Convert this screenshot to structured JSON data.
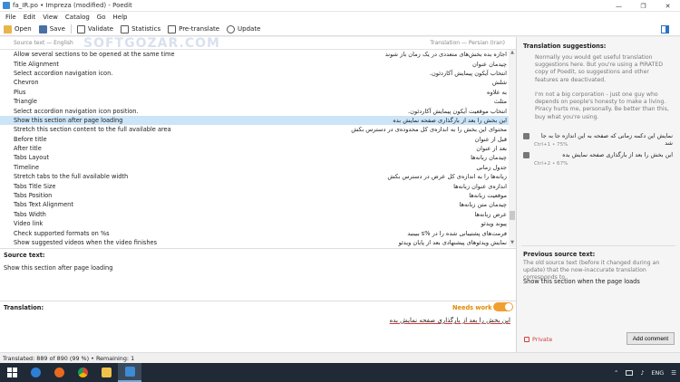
{
  "window": {
    "title": "fa_IR.po • Impreza (modified) - Poedit"
  },
  "menu": [
    "File",
    "Edit",
    "View",
    "Catalog",
    "Go",
    "Help"
  ],
  "toolbar": {
    "open": "Open",
    "save": "Save",
    "validate": "Validate",
    "statistics": "Statistics",
    "pretranslate": "Pre-translate",
    "update": "Update"
  },
  "list": {
    "source_header": "Source text — English",
    "translation_header": "Translation — Persian (Iran)",
    "rows": [
      {
        "src": "Allow several sections to be opened at the same time",
        "trn": "اجازه بده بخش‌های متعددی در یک زمان باز شوند"
      },
      {
        "src": "Title Alignment",
        "trn": "چیدمان عنوان"
      },
      {
        "src": "Select accordion navigation icon.",
        "trn": "انتخاب آیکون پیمایش آکاردئون."
      },
      {
        "src": "Chevron",
        "trn": "شلش"
      },
      {
        "src": "Plus",
        "trn": "به علاوه"
      },
      {
        "src": "Triangle",
        "trn": "مثلث"
      },
      {
        "src": "Select accordion navigation icon position.",
        "trn": "انتخاب موقعیت آیکون پیمایش آکاردئون."
      },
      {
        "src": "Show this section after page loading",
        "trn": "این بخش را بعد از بارگذاری صفحه نمایش بده",
        "selected": true
      },
      {
        "src": "Stretch this section content to the full available area",
        "trn": "محتوای این بخش را به اندازه‌ی کل محدوده‌ی در دسترس بکش"
      },
      {
        "src": "Before title",
        "trn": "قبل از عنوان"
      },
      {
        "src": "After title",
        "trn": "بعد از عنوان"
      },
      {
        "src": "Tabs Layout",
        "trn": "چیدمان زبانه‌ها"
      },
      {
        "src": "Timeline",
        "trn": "جدول زمانی"
      },
      {
        "src": "Stretch tabs to the full available width",
        "trn": "زبانه‌ها را به اندازه‌ی کل عرض در دسترس بکش"
      },
      {
        "src": "Tabs Title Size",
        "trn": "اندازه‌ی عنوان زبانه‌ها"
      },
      {
        "src": "Tabs Position",
        "trn": "موقعیت زبانه‌ها"
      },
      {
        "src": "Tabs Text Alignment",
        "trn": "چیدمان متن زبانه‌ها"
      },
      {
        "src": "Tabs Width",
        "trn": "عرض زبانه‌ها"
      },
      {
        "src": "Video link",
        "trn": "پیوند ویدئو"
      },
      {
        "src": "Check supported formats on %s",
        "trn": "فرمت‌های پشتیبانی شده را در %s ببینید"
      },
      {
        "src": "Show suggested videos when the video finishes",
        "trn": "نمایش ویدئوهای پیشنهادی بعد از پایان ویدئو"
      }
    ]
  },
  "editor": {
    "source_label": "Source text:",
    "source_text": "Show this section after page loading",
    "translation_label": "Translation:",
    "needs_work": "Needs work",
    "translation_text": "این بخش را بعد از بارگذاری صفحه نمایش بده"
  },
  "sidebar": {
    "title": "Translation suggestions:",
    "note1": "Normally you would get useful translation suggestions here. But you're using a PIRATED copy of Poedit, so suggestions and other features are deactivated.",
    "note2": "I'm not a big corporation - just one guy who depends on people's honesty to make a living. Piracy hurts me, personally. Be better than this, buy what you're using.",
    "suggestions": [
      {
        "text": "نمایش این دکمه زمانی که صفحه به این اندازه جا به جا شد",
        "meta": "Ctrl+1 • 75%"
      },
      {
        "text": "این بخش را بعد از بارگذاری صفحه نمایش بده",
        "meta": "Ctrl+2 • 67%"
      }
    ],
    "prev_title": "Previous source text:",
    "prev_desc": "The old source text (before it changed during an update) that the now-inaccurate translation corresponds to.",
    "prev_text": "Show this section when the page loads",
    "private": "Private",
    "add_comment": "Add comment"
  },
  "status": "Translated: 889 of 890 (99 %)  •  Remaining: 1",
  "tray": {
    "lang": "ENG"
  },
  "watermark": "SOFTGOZAR.COM"
}
